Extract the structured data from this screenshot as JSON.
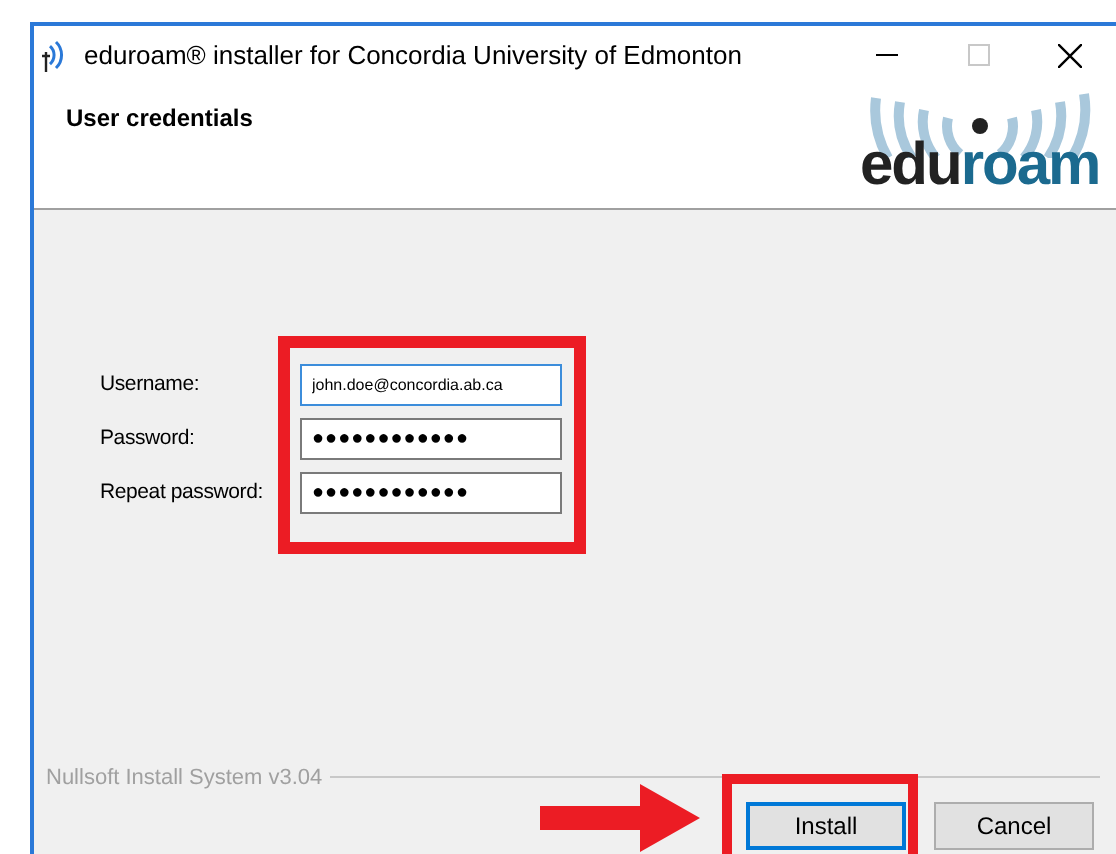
{
  "window": {
    "title": "eduroam® installer for Concordia University of Edmonton",
    "maximize_disabled": true
  },
  "header": {
    "title": "User credentials",
    "logo_parts": [
      "edu",
      "roam"
    ]
  },
  "fields": [
    {
      "label": "Username:",
      "value": "john.doe@concordia.ab.ca",
      "focused": true,
      "kind": "text"
    },
    {
      "label": "Password:",
      "value": "●●●●●●●●●●●●",
      "focused": false,
      "kind": "secret"
    },
    {
      "label": "Repeat password:",
      "value": "●●●●●●●●●●●●",
      "focused": false,
      "kind": "secret"
    }
  ],
  "footer": {
    "branding": "Nullsoft Install System v3.04"
  },
  "buttons": [
    {
      "label": "Install",
      "default": true
    },
    {
      "label": "Cancel",
      "default": false
    }
  ]
}
